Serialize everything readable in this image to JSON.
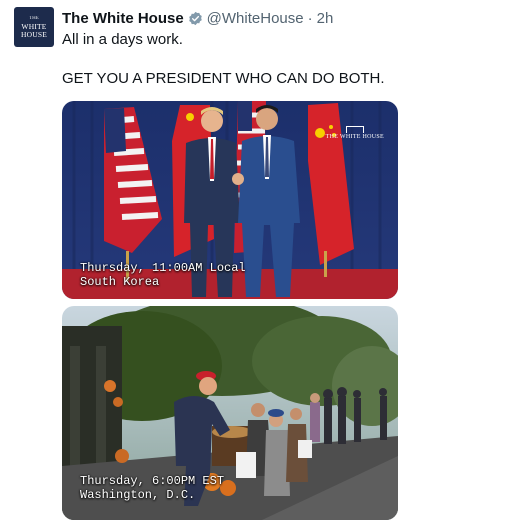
{
  "post": {
    "avatar": {
      "line1": "THE",
      "line2": "WHITE",
      "line3": "HOUSE"
    },
    "author_name": "The White House",
    "handle": "@WhiteHouse",
    "separator": "·",
    "time": "2h",
    "text_line1": "All in a days work.",
    "text_line2": "GET YOU A PRESIDENT WHO CAN DO BOTH.",
    "colors": {
      "verified_badge": "#829aab",
      "handle": "#536471",
      "text": "#0f1419"
    }
  },
  "media": [
    {
      "caption_line1": "Thursday, 11:00AM Local",
      "caption_line2": "South Korea",
      "watermark": "THE WHITE HOUSE"
    },
    {
      "caption_line1": "Thursday, 6:00PM EST",
      "caption_line2": "Washington, D.C."
    }
  ]
}
